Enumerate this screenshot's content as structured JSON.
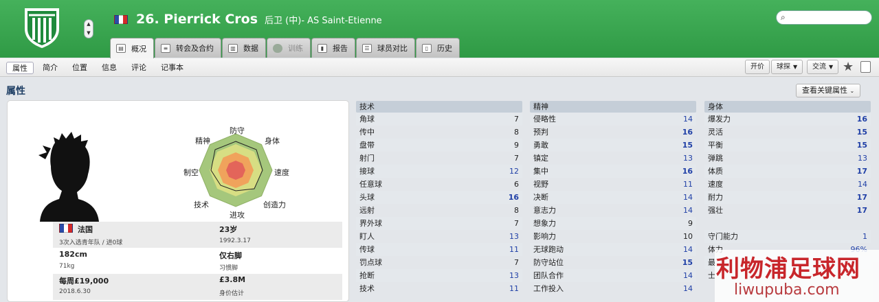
{
  "header": {
    "player_name": "26. Pierrick Cros",
    "player_sub": "后卫 (中)- AS Saint-Etienne",
    "colors": {
      "header_green": "#3aa651",
      "value_blue": "#1f3fa6"
    },
    "tabs": [
      {
        "label": "概况",
        "icon": "person-card-icon"
      },
      {
        "label": "转会及合约",
        "icon": "contract-icon"
      },
      {
        "label": "数据",
        "icon": "stats-icon"
      },
      {
        "label": "训练",
        "icon": "training-icon"
      },
      {
        "label": "报告",
        "icon": "report-icon"
      },
      {
        "label": "球员对比",
        "icon": "compare-icon"
      },
      {
        "label": "历史",
        "icon": "history-icon"
      }
    ]
  },
  "subnav": {
    "items": [
      "属性",
      "简介",
      "位置",
      "信息",
      "评论",
      "记事本"
    ],
    "right": {
      "offer": "开价",
      "scout": "球探",
      "interact": "交流"
    }
  },
  "section": {
    "title": "属性",
    "key_attr_button": "查看关键属性"
  },
  "profile": {
    "radar_labels": {
      "top": "防守",
      "tr": "身体",
      "r": "速度",
      "br": "创造力",
      "bottom": "进攻",
      "bl": "技术",
      "l": "制空",
      "tl": "精神"
    },
    "nation": "法国",
    "caps": "3次入选青年队 / 进0球",
    "age": "23岁",
    "dob": "1992.3.17",
    "height": "182cm",
    "weight": "71kg",
    "foot": "仅右脚",
    "foot_label": "习惯脚",
    "wage": "每周£19,000",
    "contract_end": "2018.6.30",
    "value": "£3.8M",
    "value_label": "身价估计"
  },
  "technical": {
    "title": "技术",
    "rows": [
      {
        "name": "角球",
        "value": "7"
      },
      {
        "name": "传中",
        "value": "8"
      },
      {
        "name": "盘带",
        "value": "9"
      },
      {
        "name": "射门",
        "value": "7"
      },
      {
        "name": "接球",
        "value": "12"
      },
      {
        "name": "任意球",
        "value": "6"
      },
      {
        "name": "头球",
        "value": "16"
      },
      {
        "name": "远射",
        "value": "8"
      },
      {
        "name": "界外球",
        "value": "7"
      },
      {
        "name": "盯人",
        "value": "13"
      },
      {
        "name": "传球",
        "value": "11"
      },
      {
        "name": "罚点球",
        "value": "7"
      },
      {
        "name": "抢断",
        "value": "13"
      },
      {
        "name": "技术",
        "value": "11"
      }
    ]
  },
  "mental": {
    "title": "精神",
    "rows": [
      {
        "name": "侵略性",
        "value": "14"
      },
      {
        "name": "预判",
        "value": "16"
      },
      {
        "name": "勇敢",
        "value": "15"
      },
      {
        "name": "镇定",
        "value": "13"
      },
      {
        "name": "集中",
        "value": "16"
      },
      {
        "name": "视野",
        "value": "11"
      },
      {
        "name": "决断",
        "value": "14"
      },
      {
        "name": "意志力",
        "value": "14"
      },
      {
        "name": "想象力",
        "value": "9"
      },
      {
        "name": "影响力",
        "value": "10"
      },
      {
        "name": "无球跑动",
        "value": "14"
      },
      {
        "name": "防守站位",
        "value": "15"
      },
      {
        "name": "团队合作",
        "value": "14"
      },
      {
        "name": "工作投入",
        "value": "14"
      }
    ]
  },
  "physical": {
    "title": "身体",
    "rows": [
      {
        "name": "爆发力",
        "value": "16"
      },
      {
        "name": "灵活",
        "value": "15"
      },
      {
        "name": "平衡",
        "value": "15"
      },
      {
        "name": "弹跳",
        "value": "13"
      },
      {
        "name": "体质",
        "value": "17"
      },
      {
        "name": "速度",
        "value": "14"
      },
      {
        "name": "耐力",
        "value": "17"
      },
      {
        "name": "强壮",
        "value": "17"
      }
    ],
    "goalkeeping": {
      "name": "守门能力",
      "value": "1"
    },
    "condition": {
      "name": "体力",
      "value": "96%"
    },
    "extra1": "最",
    "extra2": "士"
  },
  "watermark": {
    "cn": "利物浦足球网",
    "url": "liwupuba.com"
  }
}
